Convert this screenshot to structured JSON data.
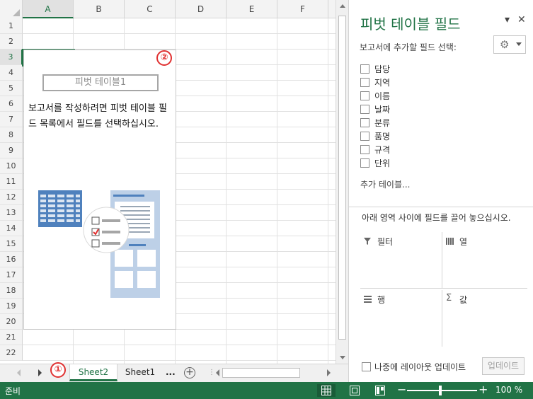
{
  "grid": {
    "columns": [
      "A",
      "B",
      "C",
      "D",
      "E",
      "F"
    ],
    "selected_column": "A",
    "rows": [
      "1",
      "2",
      "3",
      "4",
      "5",
      "6",
      "7",
      "8",
      "9",
      "10",
      "11",
      "12",
      "13",
      "14",
      "15",
      "16",
      "17",
      "18",
      "19",
      "20",
      "21",
      "22"
    ],
    "selected_row": "3"
  },
  "pivot_placeholder": {
    "title": "피벗 테이블1",
    "message": "보고서를 작성하려면 피벗 테이블 필드 목록에서 필드를 선택하십시오.",
    "badge": "②"
  },
  "tabs": {
    "badge": "①",
    "sheets": [
      "Sheet2",
      "Sheet1"
    ],
    "active": "Sheet2",
    "more": "...",
    "add_label": "+"
  },
  "pane": {
    "title": "피벗 테이블 필드",
    "dropdown_glyph": "▾",
    "close_glyph": "✕",
    "subtitle": "보고서에 추가할 필드 선택:",
    "gear_glyph": "⚙",
    "fields": [
      "담당",
      "지역",
      "이름",
      "날짜",
      "분류",
      "품명",
      "규격",
      "단위"
    ],
    "more_tables": "추가 테이블...",
    "areas_hint": "아래 영역 사이에 필드를 끌어 놓으십시오.",
    "areas": {
      "filter": {
        "label": "필터",
        "icon": "filter-icon"
      },
      "columns": {
        "label": "열",
        "icon": "columns-icon"
      },
      "rows": {
        "label": "행",
        "icon": "rows-icon"
      },
      "values": {
        "label": "값",
        "icon": "sigma-icon"
      }
    },
    "defer_label": "나중에 레이아웃 업데이트",
    "update_button": "업데이트"
  },
  "status": {
    "ready": "준비",
    "zoom": "100 %"
  },
  "colors": {
    "accent": "#217346",
    "badge": "#e03030"
  }
}
